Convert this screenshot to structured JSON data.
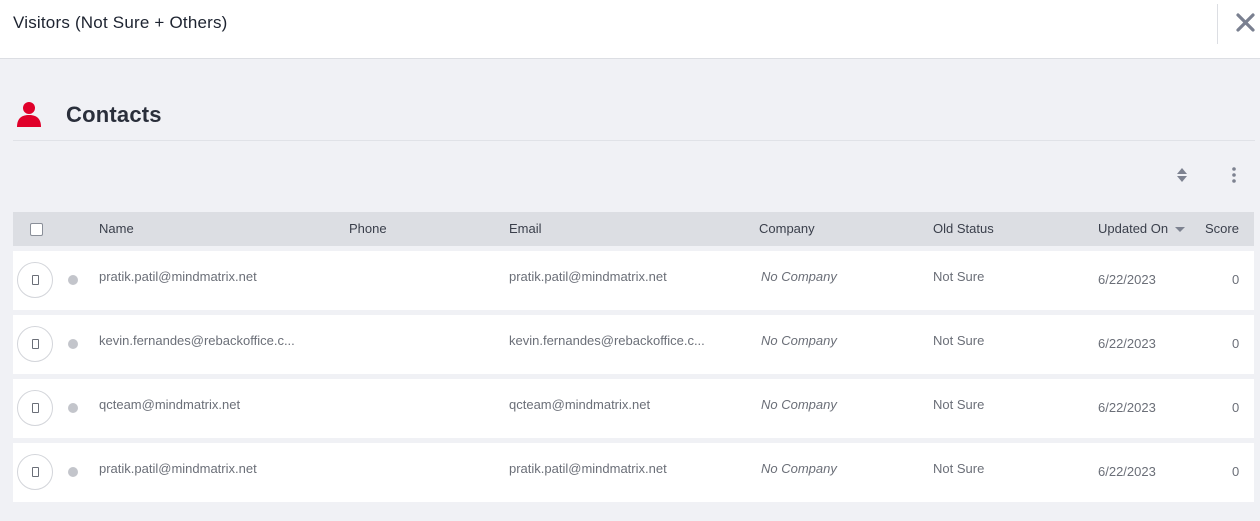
{
  "header": {
    "title": "Visitors (Not Sure + Others)"
  },
  "section": {
    "title": "Contacts",
    "icon": "person-icon",
    "accent": "#e0002a"
  },
  "toolbar": {
    "sort_icon": "sort-icon",
    "more_icon": "more-vertical-icon"
  },
  "table": {
    "columns": {
      "name": "Name",
      "phone": "Phone",
      "email": "Email",
      "company": "Company",
      "old_status": "Old Status",
      "updated_on": "Updated On",
      "score": "Score"
    },
    "rows": [
      {
        "name": "pratik.patil@mindmatrix.net",
        "phone": "",
        "email": "pratik.patil@mindmatrix.net",
        "company": "No Company",
        "old_status": "Not Sure",
        "updated_on": "6/22/2023",
        "score": "0"
      },
      {
        "name": "kevin.fernandes@rebackoffice.c...",
        "phone": "",
        "email": "kevin.fernandes@rebackoffice.c...",
        "company": "No Company",
        "old_status": "Not Sure",
        "updated_on": "6/22/2023",
        "score": "0"
      },
      {
        "name": "qcteam@mindmatrix.net",
        "phone": "",
        "email": "qcteam@mindmatrix.net",
        "company": "No Company",
        "old_status": "Not Sure",
        "updated_on": "6/22/2023",
        "score": "0"
      },
      {
        "name": "pratik.patil@mindmatrix.net",
        "phone": "",
        "email": "pratik.patil@mindmatrix.net",
        "company": "No Company",
        "old_status": "Not Sure",
        "updated_on": "6/22/2023",
        "score": "0"
      }
    ]
  }
}
